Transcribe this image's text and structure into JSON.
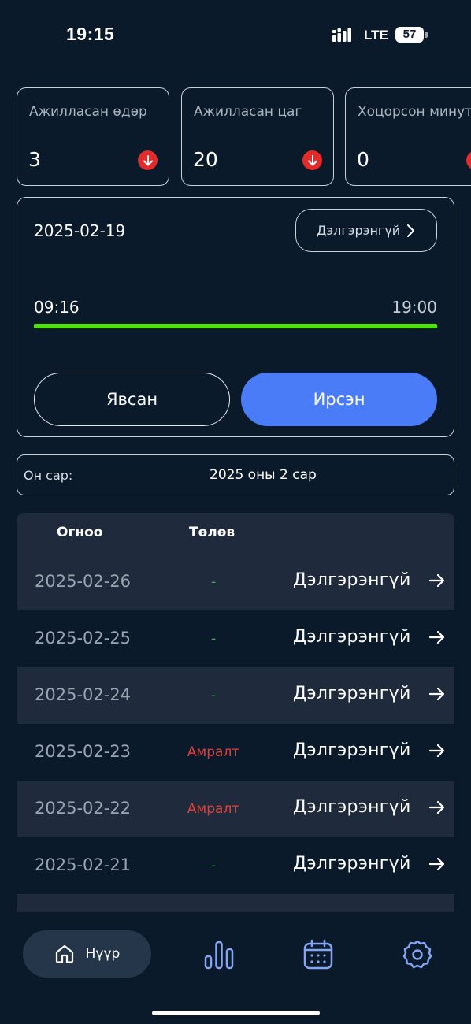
{
  "status_bar": {
    "time": "19:15",
    "network": "LTE",
    "battery": "57"
  },
  "stats": [
    {
      "label": "Ажилласан өдөр",
      "value": "3"
    },
    {
      "label": "Ажилласан цаг",
      "value": "20"
    },
    {
      "label": "Хоцорсон минут",
      "value": "0"
    }
  ],
  "today": {
    "date": "2025-02-19",
    "detail_label": "Дэлгэрэнгүй",
    "start_time": "09:16",
    "end_time": "19:00",
    "progress": 1.0,
    "left_button": "Явсан",
    "right_button": "Ирсэн"
  },
  "month_filter": {
    "label": "Он сар:",
    "value": "2025 оны 2 сар"
  },
  "table": {
    "headers": {
      "date": "Огноо",
      "status": "Төлөв"
    },
    "rows": [
      {
        "date": "2025-02-26",
        "status": "-",
        "detail": "Дэлгэрэнгүй"
      },
      {
        "date": "2025-02-25",
        "status": "-",
        "detail": "Дэлгэрэнгүй"
      },
      {
        "date": "2025-02-24",
        "status": "-",
        "detail": "Дэлгэрэнгүй"
      },
      {
        "date": "2025-02-23",
        "status": "Амралт",
        "detail": "Дэлгэрэнгүй"
      },
      {
        "date": "2025-02-22",
        "status": "Амралт",
        "detail": "Дэлгэрэнгүй"
      },
      {
        "date": "2025-02-21",
        "status": "-",
        "detail": "Дэлгэрэнгүй"
      }
    ]
  },
  "tabbar": {
    "home_label": "Нүүр",
    "icons": [
      "home-icon",
      "bar-chart-icon",
      "calendar-icon",
      "settings-gear-icon"
    ]
  },
  "colors": {
    "background": "#0b1a2b",
    "accent_blue": "#4a7cf7",
    "progress_green": "#4de20e",
    "status_dash_green": "#3bb64a",
    "status_rest_red": "#e0403a",
    "badge_red": "#e42b2b",
    "tab_icon_blue": "#86a6f5"
  }
}
